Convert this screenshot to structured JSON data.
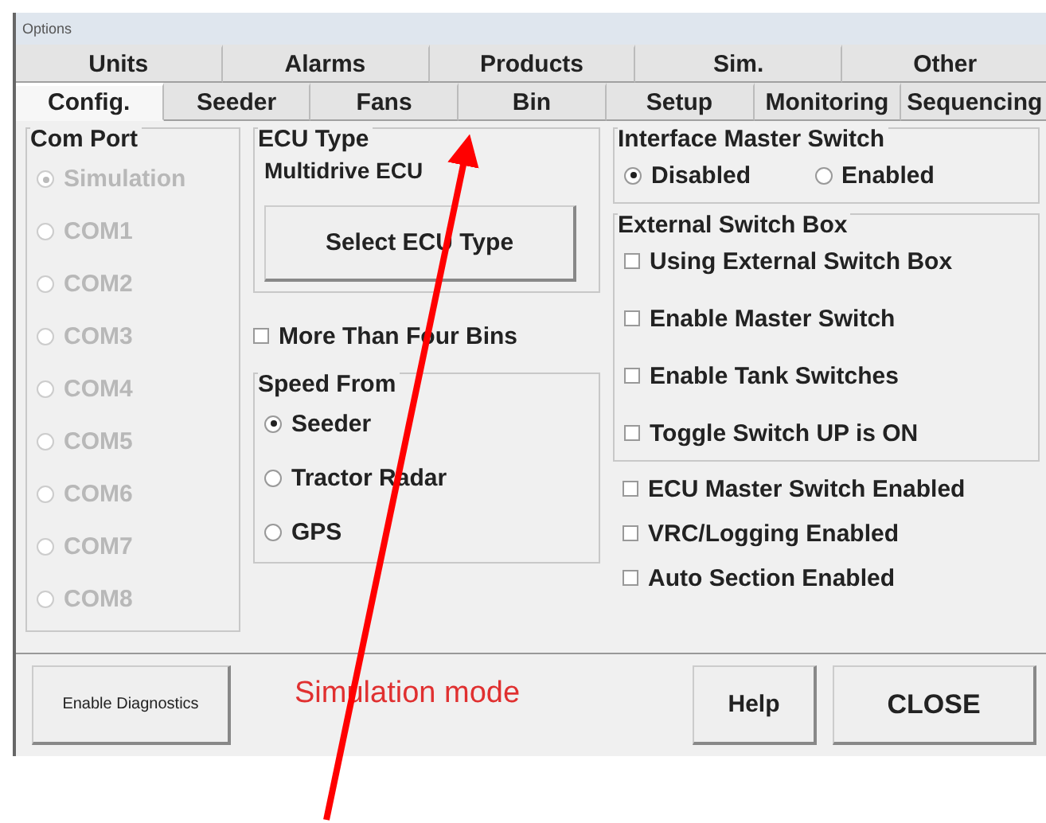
{
  "window": {
    "title": "Options"
  },
  "tab_rows": [
    [
      {
        "label": "Units",
        "selected": false
      },
      {
        "label": "Alarms",
        "selected": false
      },
      {
        "label": "Products",
        "selected": false
      },
      {
        "label": "Sim.",
        "selected": false
      },
      {
        "label": "Other",
        "selected": false
      }
    ],
    [
      {
        "label": "Config.",
        "selected": true
      },
      {
        "label": "Seeder",
        "selected": false
      },
      {
        "label": "Fans",
        "selected": false
      },
      {
        "label": "Bin",
        "selected": false
      },
      {
        "label": "Setup",
        "selected": false
      },
      {
        "label": "Monitoring",
        "selected": false
      },
      {
        "label": "Sequencing",
        "selected": false
      }
    ]
  ],
  "com_port": {
    "title": "Com Port",
    "options": [
      {
        "label": "Simulation",
        "selected": true,
        "disabled": true
      },
      {
        "label": "COM1",
        "selected": false,
        "disabled": true
      },
      {
        "label": "COM2",
        "selected": false,
        "disabled": true
      },
      {
        "label": "COM3",
        "selected": false,
        "disabled": true
      },
      {
        "label": "COM4",
        "selected": false,
        "disabled": true
      },
      {
        "label": "COM5",
        "selected": false,
        "disabled": true
      },
      {
        "label": "COM6",
        "selected": false,
        "disabled": true
      },
      {
        "label": "COM7",
        "selected": false,
        "disabled": true
      },
      {
        "label": "COM8",
        "selected": false,
        "disabled": true
      }
    ]
  },
  "ecu_type": {
    "title": "ECU Type",
    "value": "Multidrive ECU",
    "button": "Select ECU Type"
  },
  "more_than_four_bins": {
    "label": "More Than Four Bins",
    "checked": false
  },
  "speed_from": {
    "title": "Speed From",
    "options": [
      {
        "label": "Seeder",
        "selected": true
      },
      {
        "label": "Tractor Radar",
        "selected": false
      },
      {
        "label": "GPS",
        "selected": false
      }
    ]
  },
  "interface_master_switch": {
    "title": "Interface Master Switch",
    "options": [
      {
        "label": "Disabled",
        "selected": true
      },
      {
        "label": "Enabled",
        "selected": false
      }
    ]
  },
  "external_switch_box": {
    "title": "External Switch Box",
    "options": [
      {
        "label": "Using External Switch Box",
        "checked": false
      },
      {
        "label": "Enable Master Switch",
        "checked": false
      },
      {
        "label": "Enable Tank Switches",
        "checked": false
      },
      {
        "label": "Toggle Switch UP is ON",
        "checked": false
      }
    ]
  },
  "flags": [
    {
      "label": "ECU Master Switch Enabled",
      "checked": false
    },
    {
      "label": "VRC/Logging Enabled",
      "checked": false
    },
    {
      "label": "Auto Section Enabled",
      "checked": false
    }
  ],
  "footer": {
    "diagnostics_button": "Enable Diagnostics",
    "status": "Simulation mode",
    "help_button": "Help",
    "close_button": "CLOSE"
  }
}
